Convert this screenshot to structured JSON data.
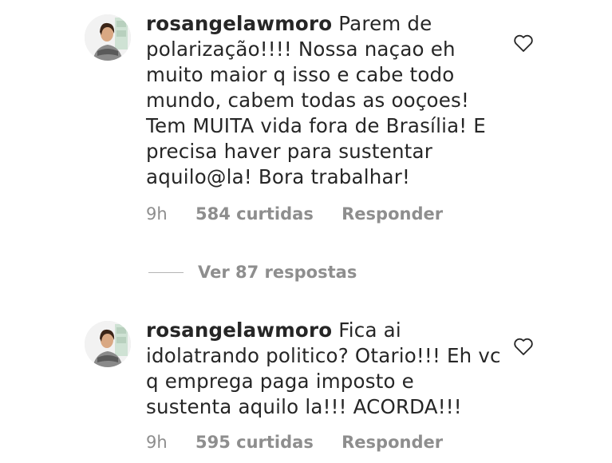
{
  "comments": [
    {
      "username": "rosangelawmoro",
      "text": "Parem de polarização!!!! Nossa naçao eh muito maior q isso e cabe todo mundo, cabem todas as ooçoes! Tem MUITA vida fora de Brasília! E precisa haver para sustentar aquilo@la!  Bora trabalhar!",
      "time": "9h",
      "likes": "584 curtidas",
      "reply_label": "Responder",
      "like_icon": "heart-outline-icon"
    },
    {
      "username": "rosangelawmoro",
      "text": "Fica ai idolatrando politico? Otario!!! Eh vc q emprega paga imposto e sustenta aquilo la!!! ACORDA!!!",
      "time": "9h",
      "likes": "595 curtidas",
      "reply_label": "Responder",
      "like_icon": "heart-outline-icon"
    }
  ],
  "view_replies_label": "Ver 87 respostas"
}
